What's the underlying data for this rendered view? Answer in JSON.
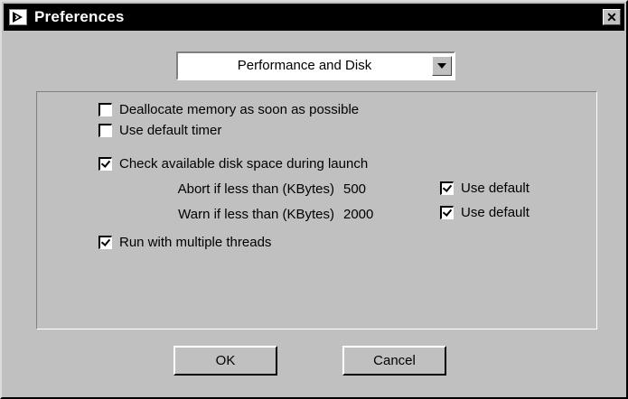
{
  "window": {
    "title": "Preferences",
    "close_label": "✕"
  },
  "category_select": {
    "value": "Performance and Disk"
  },
  "options": {
    "deallocate_memory": {
      "label": "Deallocate memory as soon as possible",
      "checked": false
    },
    "default_timer": {
      "label": "Use default timer",
      "checked": false
    },
    "check_disk_space": {
      "label": "Check available disk space during launch",
      "checked": true
    },
    "multiple_threads": {
      "label": "Run with multiple threads",
      "checked": true
    }
  },
  "disk_limits": {
    "abort": {
      "label": "Abort if less than (KBytes)",
      "value": "500",
      "use_default_label": "Use default",
      "use_default_checked": true
    },
    "warn": {
      "label": "Warn if less than (KBytes)",
      "value": "2000",
      "use_default_label": "Use default",
      "use_default_checked": true
    }
  },
  "buttons": {
    "ok": "OK",
    "cancel": "Cancel"
  }
}
